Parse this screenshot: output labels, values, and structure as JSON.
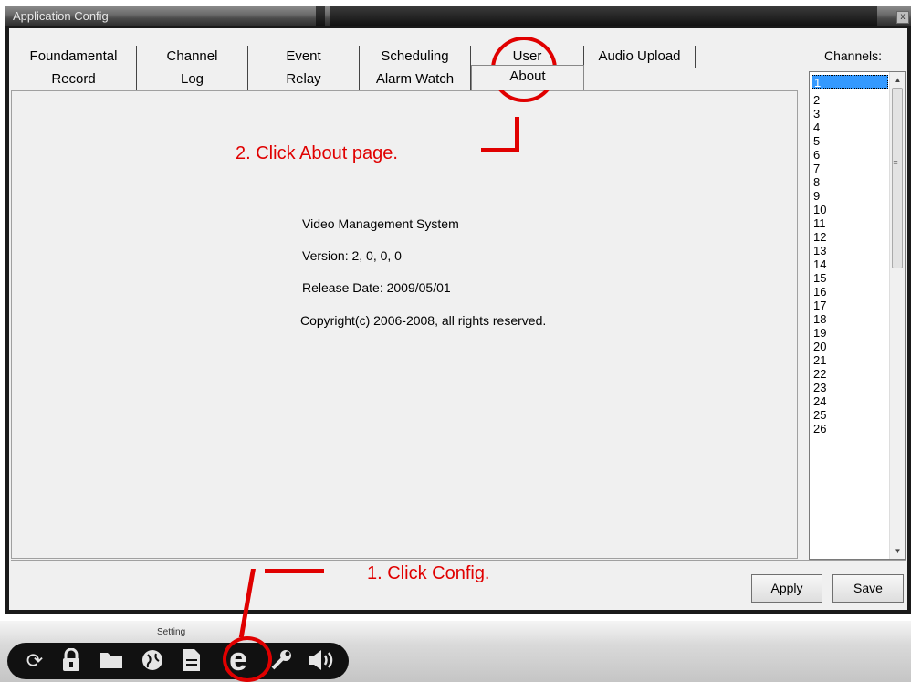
{
  "window": {
    "title": "Application Config",
    "close_glyph": "x"
  },
  "tabs_row1": [
    "Foundamental",
    "Channel",
    "Event",
    "Scheduling",
    "User",
    "Audio Upload"
  ],
  "tabs_row2": [
    "Record",
    "Log",
    "Relay",
    "Alarm Watch",
    "About"
  ],
  "active_tab": "About",
  "about": {
    "product": "Video Management System",
    "version": "Version: 2, 0, 0, 0",
    "release_date": "Release Date: 2009/05/01",
    "copyright": "Copyright(c) 2006-2008, all rights reserved."
  },
  "channels": {
    "label": "Channels:",
    "items": [
      "1",
      "2",
      "3",
      "4",
      "5",
      "6",
      "7",
      "8",
      "9",
      "10",
      "11",
      "12",
      "13",
      "14",
      "15",
      "16",
      "17",
      "18",
      "19",
      "20",
      "21",
      "22",
      "23",
      "24",
      "25",
      "26"
    ],
    "selected": "1"
  },
  "buttons": {
    "apply": "Apply",
    "save": "Save"
  },
  "toolbar": {
    "label": "Setting",
    "icons": [
      "refresh-icon",
      "lock-icon",
      "folder-icon",
      "globe-icon",
      "document-icon",
      "ie-config-icon",
      "wrench-icon",
      "speaker-icon"
    ]
  },
  "annotations": {
    "step1": "1. Click Config.",
    "step2": "2. Click About page."
  },
  "colors": {
    "annotation_red": "#e00000",
    "selection_blue": "#3399ff"
  }
}
